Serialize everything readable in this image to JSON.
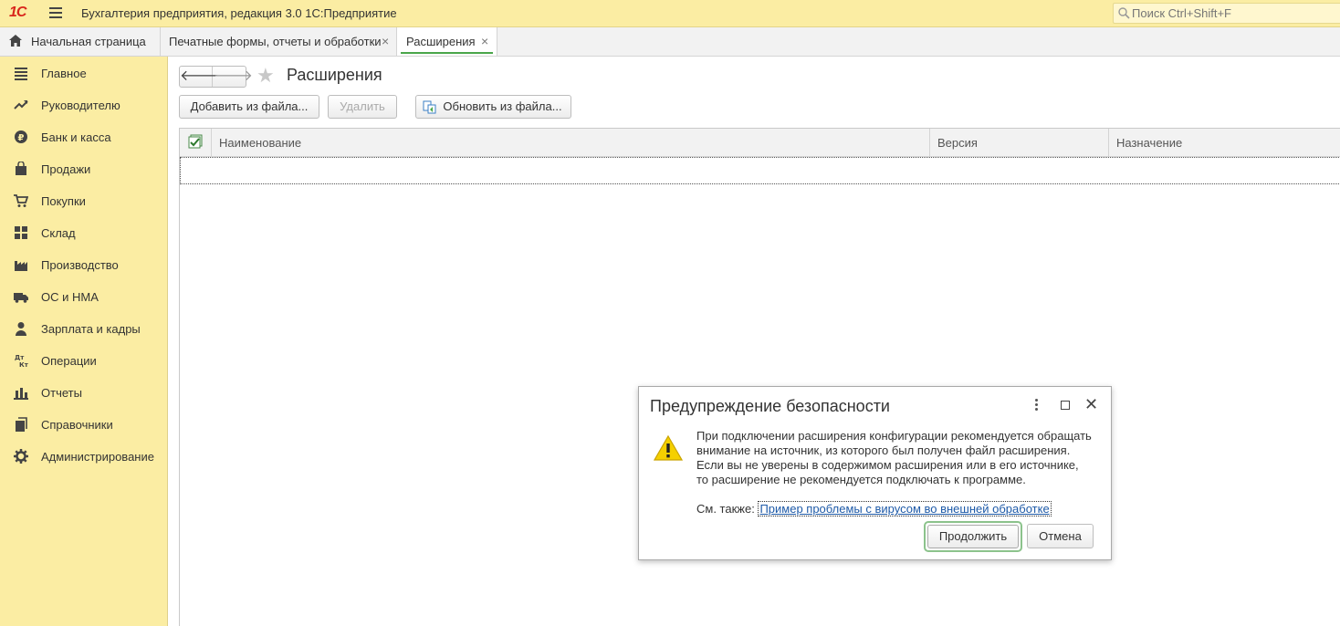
{
  "app": {
    "logo_text": "1С",
    "title": "Бухгалтерия предприятия, редакция 3.0 1С:Предприятие",
    "search_placeholder": "Поиск Ctrl+Shift+F"
  },
  "tabs": [
    {
      "label": "Начальная страница"
    },
    {
      "label": "Печатные формы, отчеты и обработки"
    },
    {
      "label": "Расширения"
    }
  ],
  "sidebar": {
    "items": [
      {
        "label": "Главное",
        "icon": "list-icon"
      },
      {
        "label": "Руководителю",
        "icon": "trend-icon"
      },
      {
        "label": "Банк и касса",
        "icon": "ruble-icon"
      },
      {
        "label": "Продажи",
        "icon": "bag-icon"
      },
      {
        "label": "Покупки",
        "icon": "cart-icon"
      },
      {
        "label": "Склад",
        "icon": "warehouse-icon"
      },
      {
        "label": "Производство",
        "icon": "factory-icon"
      },
      {
        "label": "ОС и НМА",
        "icon": "truck-icon"
      },
      {
        "label": "Зарплата и кадры",
        "icon": "person-icon"
      },
      {
        "label": "Операции",
        "icon": "dt-kt-icon"
      },
      {
        "label": "Отчеты",
        "icon": "bar-chart-icon"
      },
      {
        "label": "Справочники",
        "icon": "books-icon"
      },
      {
        "label": "Администрирование",
        "icon": "gear-icon"
      }
    ]
  },
  "page": {
    "title": "Расширения",
    "buttons": {
      "add": "Добавить из файла...",
      "delete": "Удалить",
      "update": "Обновить из файла..."
    },
    "table": {
      "columns": [
        "Наименование",
        "Версия",
        "Назначение"
      ]
    }
  },
  "dialog": {
    "title": "Предупреждение безопасности",
    "lines": [
      "При подключении расширения конфигурации рекомендуется обращать",
      "внимание на источник, из которого был получен файл расширения.",
      "Если вы не уверены в содержимом расширения или в его источнике,",
      "то расширение не рекомендуется подключать к программе."
    ],
    "see_also_label": "См. также: ",
    "see_also_link": "Пример проблемы с вирусом во внешней обработке",
    "continue_label": "Продолжить",
    "cancel_label": "Отмена"
  },
  "colors": {
    "panel_yellow": "#fbeda3",
    "accent_green": "#4aa64a",
    "logo_red": "#d9261c",
    "link_blue": "#1e5aa8"
  }
}
